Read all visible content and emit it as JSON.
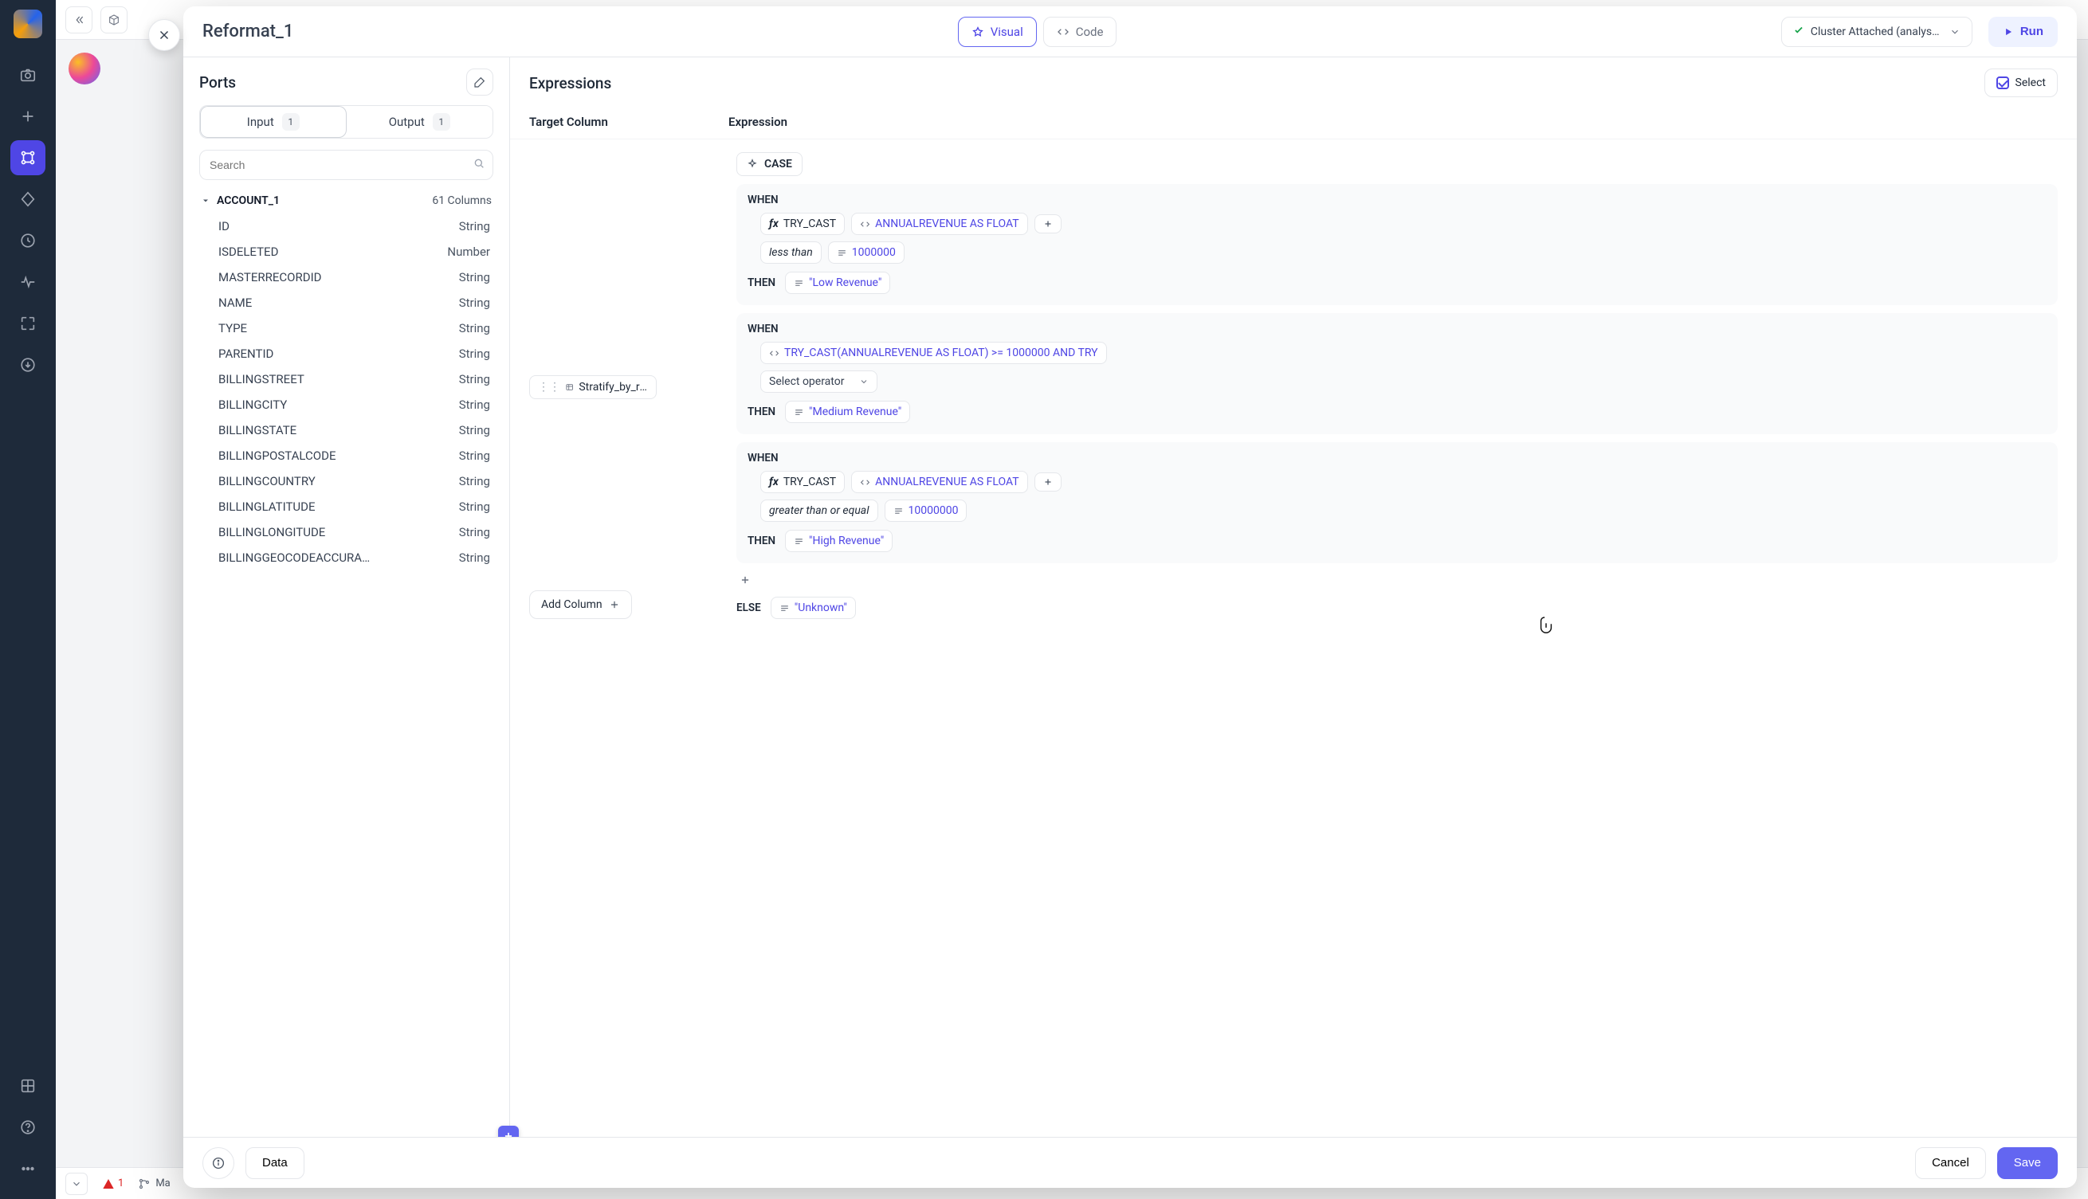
{
  "navrail": {
    "logo_alt": "App logo"
  },
  "bottombar": {
    "warnings": "1",
    "branch": "Ma"
  },
  "modal": {
    "title": "Reformat_1",
    "tabs": {
      "visual": "Visual",
      "code": "Code"
    },
    "cluster": "Cluster Attached (analyst_de…",
    "run": "Run"
  },
  "ports": {
    "heading": "Ports",
    "input_label": "Input",
    "input_count": "1",
    "output_label": "Output",
    "output_count": "1",
    "search_placeholder": "Search",
    "group_name": "ACCOUNT_1",
    "columns_label": "61 Columns",
    "columns": [
      {
        "name": "ID",
        "type": "String"
      },
      {
        "name": "ISDELETED",
        "type": "Number"
      },
      {
        "name": "MASTERRECORDID",
        "type": "String"
      },
      {
        "name": "NAME",
        "type": "String"
      },
      {
        "name": "TYPE",
        "type": "String"
      },
      {
        "name": "PARENTID",
        "type": "String"
      },
      {
        "name": "BILLINGSTREET",
        "type": "String"
      },
      {
        "name": "BILLINGCITY",
        "type": "String"
      },
      {
        "name": "BILLINGSTATE",
        "type": "String"
      },
      {
        "name": "BILLINGPOSTALCODE",
        "type": "String"
      },
      {
        "name": "BILLINGCOUNTRY",
        "type": "String"
      },
      {
        "name": "BILLINGLATITUDE",
        "type": "String"
      },
      {
        "name": "BILLINGLONGITUDE",
        "type": "String"
      },
      {
        "name": "BILLINGGEOCODEACCURA…",
        "type": "String"
      }
    ]
  },
  "expr": {
    "heading": "Expressions",
    "select": "Select",
    "th_target": "Target Column",
    "th_expr": "Expression",
    "target_chip": "Stratify_by_reve…",
    "add_column": "Add Column",
    "case_label": "CASE",
    "when_label": "WHEN",
    "then_label": "THEN",
    "else_label": "ELSE",
    "blocks": {
      "b1": {
        "fx": "TRY_CAST",
        "expr": "ANNUALREVENUE AS FLOAT",
        "op": "less than",
        "val": "1000000",
        "then": "\"Low Revenue\""
      },
      "b2": {
        "expr": "TRY_CAST(ANNUALREVENUE AS FLOAT) >= 1000000 AND TRY",
        "opselect": "Select operator",
        "then": "\"Medium Revenue\""
      },
      "b3": {
        "fx": "TRY_CAST",
        "expr": "ANNUALREVENUE AS FLOAT",
        "op": "greater than or equal",
        "val": "10000000",
        "then": "\"High Revenue\""
      },
      "else_val": "\"Unknown\""
    }
  },
  "footer": {
    "data": "Data",
    "cancel": "Cancel",
    "save": "Save"
  }
}
